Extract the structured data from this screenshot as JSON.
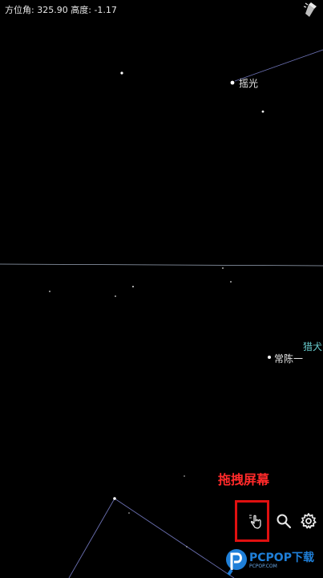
{
  "status": {
    "azimuth_label": "方位角:",
    "azimuth_value": "325.90",
    "altitude_label": "高度:",
    "altitude_value": "-1.17"
  },
  "sky": {
    "star_labels": [
      "摇光",
      "常陈一"
    ],
    "constellation_labels": [
      "猎犬"
    ]
  },
  "hint": {
    "text": "拖拽屏幕"
  },
  "toolbar": {
    "drag_icon": "hand-drag-icon",
    "search_icon": "search-icon",
    "settings_icon": "gear-icon"
  },
  "watermark": {
    "brand": "PCPOP下载",
    "sub": "PCPOP.COM"
  },
  "colors": {
    "background": "#000000",
    "constellation_label": "#66c7c9",
    "hint": "#ff2a2a",
    "watermark": "#1f7fd8"
  }
}
